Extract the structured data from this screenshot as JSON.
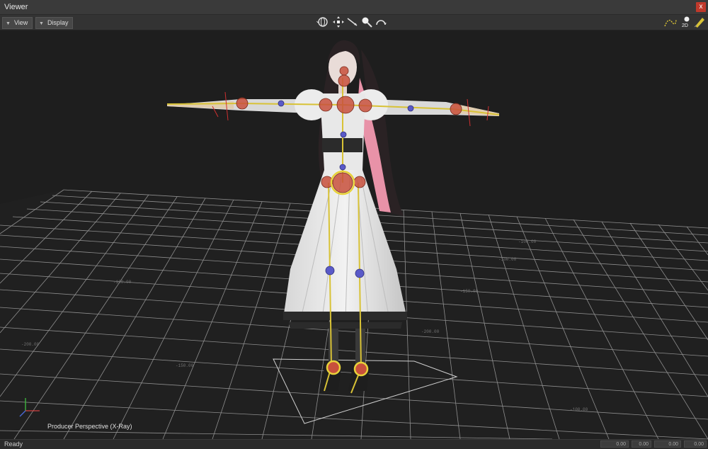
{
  "window": {
    "title": "Viewer",
    "close_label": "x"
  },
  "toolbar": {
    "menus": [
      {
        "label": "View"
      },
      {
        "label": "Display"
      }
    ],
    "center_icons": [
      "orbit-icon",
      "pan-icon",
      "dolly-icon",
      "zoom-icon",
      "undo-view-icon"
    ],
    "right_icons": [
      "curve-icon",
      "2d-view-icon",
      "pen-icon"
    ],
    "badge_2d": "2D"
  },
  "viewport": {
    "camera_label": "Producer Perspective (X-Ray)",
    "mode": "X-Ray",
    "grid_labels": [
      "-100.00",
      "-100.00",
      "-150.00",
      "-200.00",
      "-100.00",
      "-150.00",
      "-200.00",
      "-100.00"
    ]
  },
  "status": {
    "text": "Ready",
    "fields": [
      "0.00",
      "0.00",
      "0.00",
      "0.00"
    ]
  },
  "colors": {
    "skeleton": "#d8c236",
    "joint_red": "#c8503c",
    "joint_blue": "#5a5ac8",
    "grid": "#9a9a9a",
    "close": "#c0392b"
  }
}
